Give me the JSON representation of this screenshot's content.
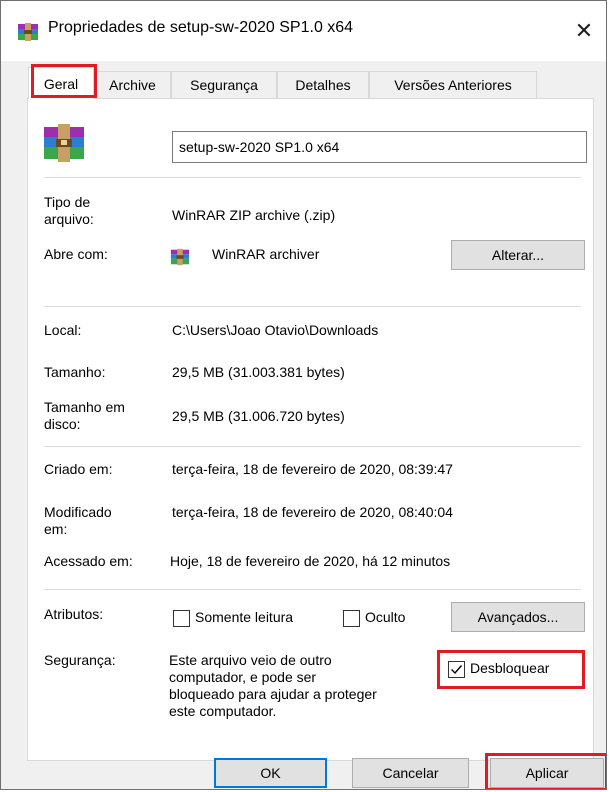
{
  "window": {
    "title": "Propriedades de setup-sw-2020 SP1.0 x64",
    "close_glyph": "✕"
  },
  "tabs": [
    {
      "label": "Geral",
      "active": true
    },
    {
      "label": "Archive",
      "active": false
    },
    {
      "label": "Segurança",
      "active": false
    },
    {
      "label": "Detalhes",
      "active": false
    },
    {
      "label": "Versões Anteriores",
      "active": false
    }
  ],
  "general": {
    "filename": "setup-sw-2020 SP1.0 x64",
    "type_label_line1": "Tipo de",
    "type_label_line2": "arquivo:",
    "type_value": "WinRAR ZIP archive (.zip)",
    "opens_with_label": "Abre com:",
    "opens_with_value": "WinRAR archiver",
    "change_button": "Alterar...",
    "location_label": "Local:",
    "location_value": "C:\\Users\\Joao Otavio\\Downloads",
    "size_label": "Tamanho:",
    "size_value": "29,5 MB (31.003.381 bytes)",
    "disk_size_label_line1": "Tamanho em",
    "disk_size_label_line2": "disco:",
    "disk_size_value": "29,5 MB (31.006.720 bytes)",
    "created_label": "Criado em:",
    "created_value": "terça-feira, 18 de fevereiro de 2020, 08:39:47",
    "modified_label_line1": "Modificado",
    "modified_label_line2": "em:",
    "modified_value": "terça-feira, 18 de fevereiro de 2020, 08:40:04",
    "accessed_label": "Acessado em:",
    "accessed_value": "Hoje, 18 de fevereiro de 2020, há 12 minutos",
    "attributes_label": "Atributos:",
    "readonly_label": "Somente leitura",
    "readonly_checked": false,
    "hidden_label": "Oculto",
    "hidden_checked": false,
    "advanced_button": "Avançados...",
    "security_label": "Segurança:",
    "security_line1": "Este arquivo veio de outro",
    "security_line2": "computador, e pode ser",
    "security_line3": "bloqueado para ajudar a proteger",
    "security_line4": "este computador.",
    "unblock_label": "Desbloquear",
    "unblock_checked": true
  },
  "footer": {
    "ok": "OK",
    "cancel": "Cancelar",
    "apply": "Aplicar"
  },
  "colors": {
    "highlight": "#e01b24",
    "default_button_border": "#0078d7"
  },
  "icons": {
    "archive": "winrar-archive-icon",
    "close": "close-icon",
    "checkmark": "checkmark-icon"
  }
}
